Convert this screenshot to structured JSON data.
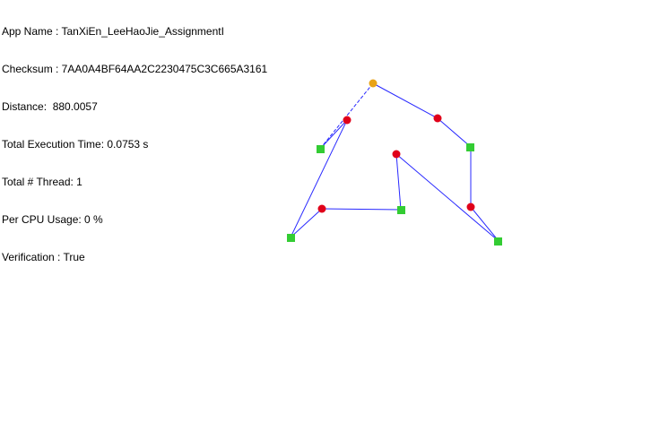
{
  "info": {
    "app_name": "App Name : TanXiEn_LeeHaoJie_AssignmentI",
    "checksum": "Checksum : 7AA0A4BF64AA2C2230475C3C665A3161",
    "distance": "Distance:  880.0057",
    "exec_time": "Total Execution Time: 0.0753 s",
    "threads": "Total # Thread: 1",
    "cpu_usage": "Per CPU Usage: 0 %",
    "verification": "Verification : True"
  },
  "colors": {
    "start_node": "#e8a317",
    "pickup_node": "#e0001a",
    "dropoff_node": "#33cc33",
    "route_line": "#2828ff",
    "return_line": "#2828ff"
  }
}
